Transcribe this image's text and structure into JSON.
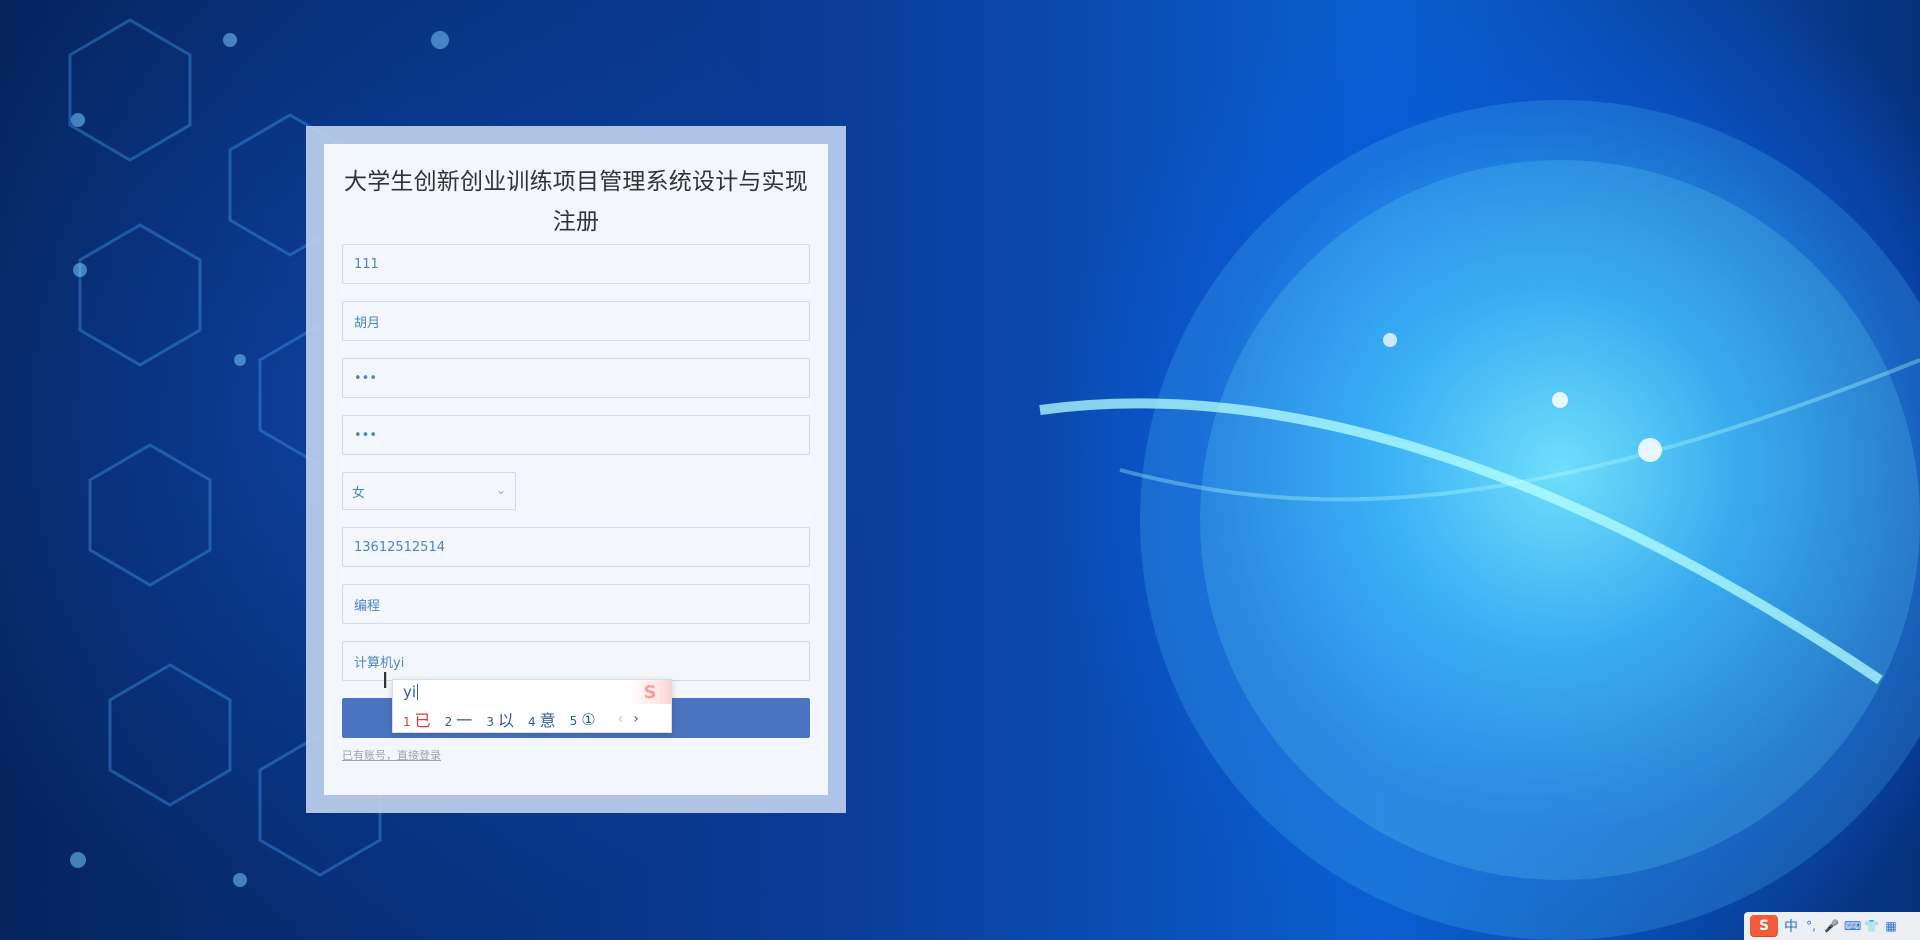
{
  "page": {
    "title": "大学生创新创业训练项目管理系统设计与实现注册"
  },
  "form": {
    "account_value": "111",
    "name_value": "胡月",
    "password_value": "•••",
    "confirm_password_value": "•••",
    "gender_selected": "女",
    "phone_value": "13612512514",
    "hobby_value": "编程",
    "major_value": "计算机yi",
    "register_button_label": "",
    "login_link_text": "已有账号，直接登录"
  },
  "ime_popup": {
    "composition": "yi",
    "brand_glyph": "S",
    "candidates": [
      {
        "num": "1",
        "text": "已",
        "active": true
      },
      {
        "num": "2",
        "text": "一",
        "active": false
      },
      {
        "num": "3",
        "text": "以",
        "active": false
      },
      {
        "num": "4",
        "text": "意",
        "active": false
      },
      {
        "num": "5",
        "text": "①",
        "active": false
      }
    ],
    "nav_prev": "‹",
    "nav_next": "›"
  },
  "tray": {
    "logo_text": "S",
    "lang_text": "中",
    "icons": [
      "punctuation-icon",
      "microphone-icon",
      "keyboard-icon",
      "shirt-icon",
      "apps-icon"
    ],
    "icon_glyphs": [
      "°,",
      "🎤",
      "⌨",
      "👕",
      "▦"
    ]
  },
  "colors": {
    "panel_bg": "#BECFED",
    "card_bg": "#F4F7FC",
    "field_text": "#4B86C6",
    "button_bg": "#4A74BF",
    "ime_active": "#E23B3B",
    "ime_text": "#2F5C9D"
  }
}
